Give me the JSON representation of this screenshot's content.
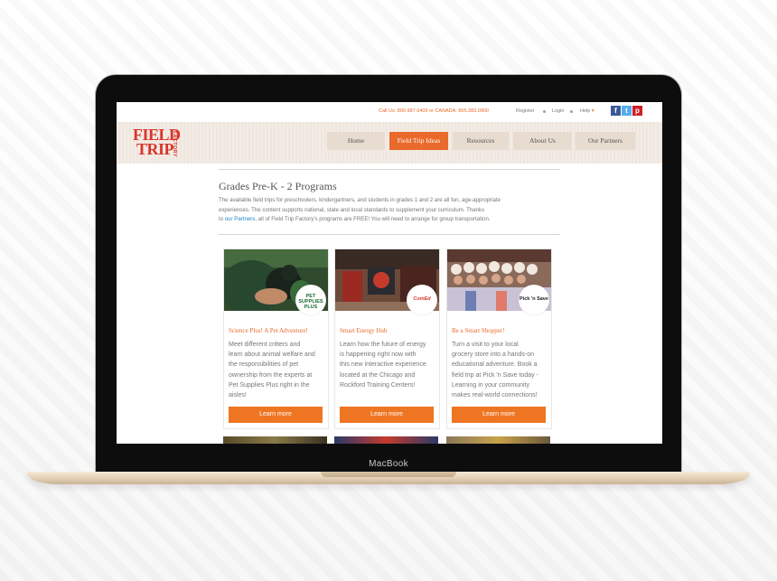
{
  "device": {
    "brand": "MacBook"
  },
  "topbar": {
    "phone": "Call Us: 800.987.6409 or CANADA: 855.383.0900",
    "register": "Register",
    "login": "Login",
    "help": "Help",
    "help_arrow": "▾",
    "social": [
      "f",
      "t",
      "p"
    ]
  },
  "logo": {
    "line1": "FIELD",
    "line2": "TRIP",
    "sub": "FACTORY"
  },
  "nav": [
    "Home",
    "Field Trip Ideas",
    "Resources",
    "About Us",
    "Our Partners"
  ],
  "page": {
    "title": "Grades Pre-K - 2 Programs",
    "intro_line1": "The available field trips for preschoolers, kindergartners, and students in grades 1 and 2 are all fun, age-appropriate",
    "intro_line2": "experiences.  The content supports national, state and local standards to supplement your curriculum.  Thanks",
    "intro_line3_a": "to ",
    "intro_line3_link": "our Partners",
    "intro_line3_b": ", all of Field Trip Factory's programs are FREE! You will need to arrange for group transportation."
  },
  "cards": [
    {
      "title": "Science Plus! A Pet Adventure!",
      "badge": "PET SUPPLIES PLUS",
      "lines": [
        "Meet different critters and",
        "learn about animal welfare and",
        "the responsibilities of pet",
        "ownership from the experts at",
        "Pet Supplies Plus right in the",
        "aisles!"
      ],
      "button": "Learn more"
    },
    {
      "title": "Smart Energy Hub",
      "badge": "ComEd",
      "lines": [
        "Learn how the future of energy",
        "is happening right now with",
        "this new interactive experience",
        "located at the Chicago and",
        "Rockford Training Centers!"
      ],
      "button": "Learn more"
    },
    {
      "title": "Be a Smart Shopper!",
      "badge": "Pick 'n Save",
      "lines": [
        "Turn a visit to your local",
        "grocery store into a hands-on",
        "educational adventure.  Book a",
        "field trip at Pick 'n Save today -",
        "Learning in your community",
        "makes real-world connections!"
      ],
      "button": "Learn more"
    }
  ],
  "colors": {
    "accent": "#ee7623",
    "logo_red": "#d9342b",
    "link": "#1e88c7"
  }
}
